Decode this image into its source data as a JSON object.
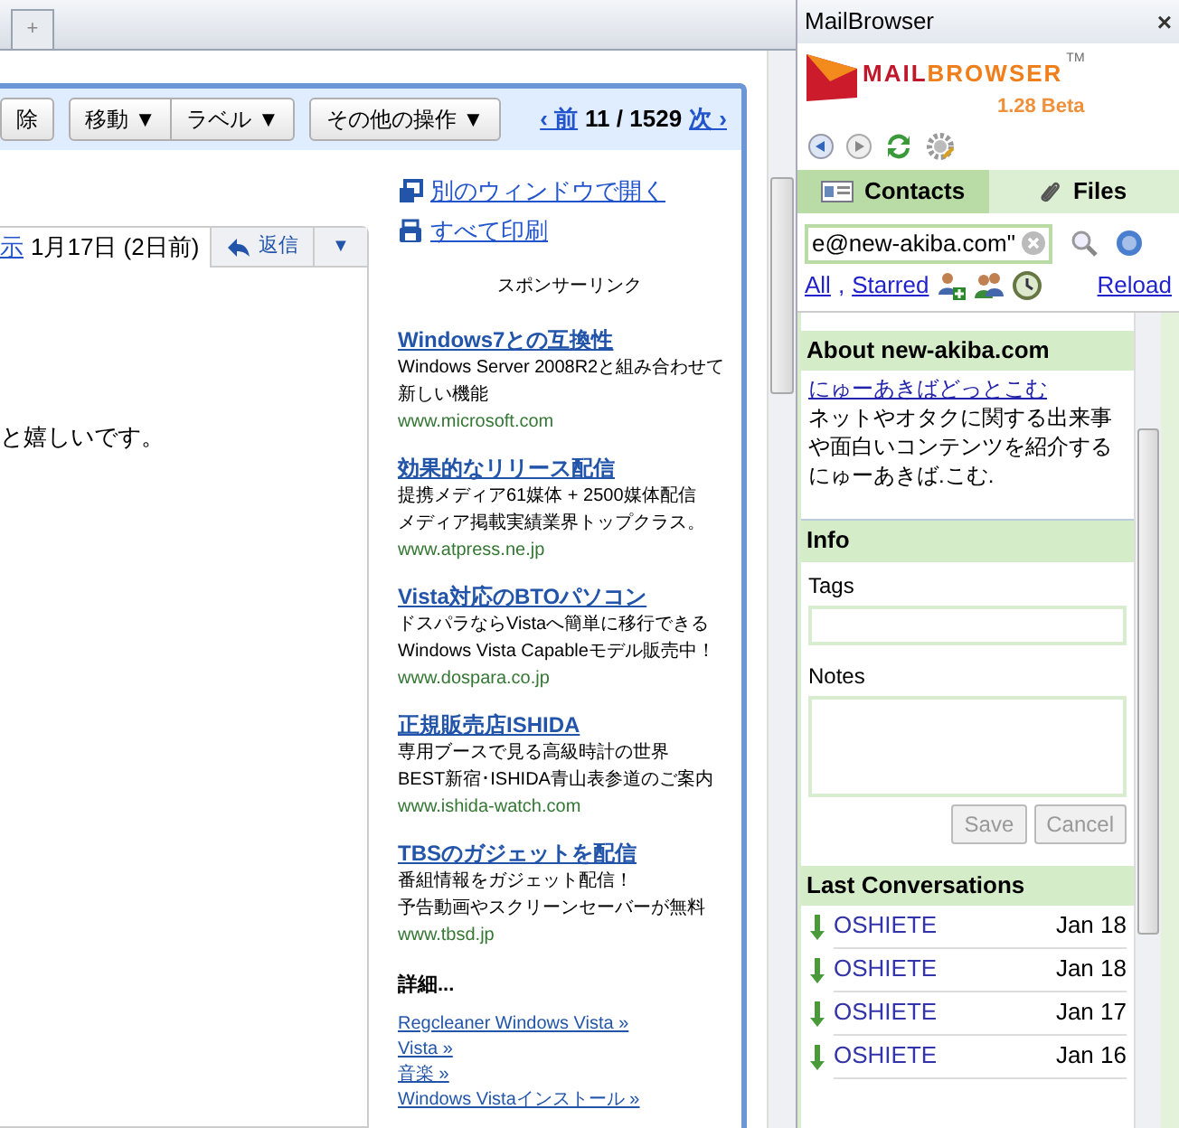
{
  "browser": {
    "new_tab": "+"
  },
  "gmail": {
    "toolbar": [
      {
        "label": "除",
        "kind": "plain"
      },
      {
        "label": "移動 ▼",
        "kind": "group-left"
      },
      {
        "label": "ラベル ▼",
        "kind": "group-right"
      },
      {
        "label": "その他の操作 ▼",
        "kind": "plain"
      }
    ],
    "pager": {
      "prev": "‹ 前",
      "count": "11 / 1529",
      "next": "次 ›"
    },
    "message": {
      "show_link": "示",
      "date": "1月17日 (2日前)",
      "reply": "返信",
      "more": "▼",
      "body": "と嬉しいです。"
    },
    "side_links": [
      {
        "label": "別のウィンドウで開く",
        "kind": "window"
      },
      {
        "label": "すべて印刷",
        "kind": "print"
      }
    ],
    "sponsor_title": "スポンサーリンク",
    "ads": [
      {
        "title": "Windows7との互換性",
        "lines": [
          "Windows Server 2008R2と組み合わせて新しい機能"
        ],
        "url": "www.microsoft.com"
      },
      {
        "title": "効果的なリリース配信",
        "lines": [
          "提携メディア61媒体 + 2500媒体配信",
          "メディア掲載実績業界トップクラス。"
        ],
        "url": "www.atpress.ne.jp"
      },
      {
        "title": "Vista対応のBTOパソコン",
        "lines": [
          "ドスパラならVistaへ簡単に移行できる",
          "Windows Vista Capableモデル販売中！"
        ],
        "url": "www.dospara.co.jp"
      },
      {
        "title": "正規販売店ISHIDA",
        "lines": [
          "専用ブースで見る高級時計の世界",
          "BEST新宿･ISHIDA青山表参道のご案内"
        ],
        "url": "www.ishida-watch.com"
      },
      {
        "title": "TBSのガジェットを配信",
        "lines": [
          "番組情報をガジェット配信！",
          "予告動画やスクリーンセーバーが無料"
        ],
        "url": "www.tbsd.jp"
      }
    ],
    "more_title": "詳細...",
    "more_links": [
      "Regcleaner Windows Vista »",
      "Vista »",
      "音楽 »",
      "Windows Vistaインストール »"
    ]
  },
  "panel": {
    "title": "MailBrowser",
    "close": "×",
    "logo_left": "MAIL",
    "logo_right": "BROWSER",
    "trademark": "TM",
    "version": "1.28 Beta",
    "tabs": [
      {
        "label": "Contacts",
        "kind": "contacts",
        "selected": true
      },
      {
        "label": "Files",
        "kind": "files",
        "selected": false
      }
    ],
    "search": {
      "value": "e@new-akiba.com\""
    },
    "filters": {
      "all": "All",
      "separator": ",",
      "starred": "Starred",
      "reload": "Reload"
    },
    "about": {
      "title": "About new-akiba.com",
      "link": "にゅーあきばどっとこむ",
      "text": "ネットやオタクに関する出来事や面白いコンテンツを紹介するにゅーあきば.こむ."
    },
    "info": {
      "title": "Info",
      "tags_label": "Tags",
      "notes_label": "Notes",
      "save": "Save",
      "cancel": "Cancel",
      "buttons_disabled": true
    },
    "conversations": {
      "title": "Last Conversations",
      "items": [
        {
          "subject": "OSHIETE",
          "date": "Jan 18"
        },
        {
          "subject": "OSHIETE",
          "date": "Jan 18"
        },
        {
          "subject": "OSHIETE",
          "date": "Jan 17"
        },
        {
          "subject": "OSHIETE",
          "date": "Jan 16"
        }
      ]
    }
  }
}
